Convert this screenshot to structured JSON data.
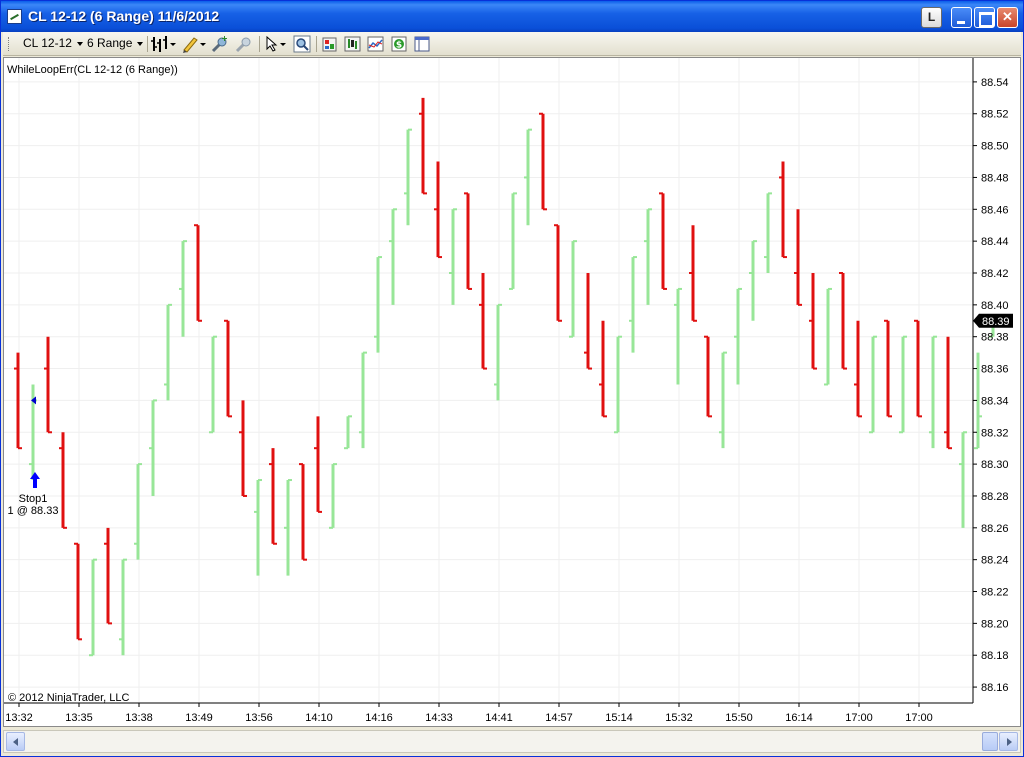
{
  "window": {
    "title": "CL 12-12 (6 Range)  11/6/2012",
    "btn_l_label": "L"
  },
  "toolbar": {
    "instrument": "CL 12-12",
    "period": "6 Range",
    "icons": [
      "bar-style-icon",
      "pencil-draw-icon",
      "zoom-in-icon",
      "zoom-out-icon",
      "pointer-icon",
      "magnifier-icon",
      "properties-icon",
      "strategies-icon",
      "indicators-icon",
      "data-box-icon",
      "window-linking-icon"
    ]
  },
  "chart_data": {
    "type": "ohlc-bar",
    "title": "WhileLoopErr(CL 12-12 (6 Range))",
    "copyright": "© 2012 NinjaTrader, LLC",
    "ylim": [
      88.15,
      88.555
    ],
    "yticks": [
      88.16,
      88.18,
      88.2,
      88.22,
      88.24,
      88.26,
      88.28,
      88.3,
      88.32,
      88.34,
      88.36,
      88.38,
      88.4,
      88.42,
      88.44,
      88.46,
      88.48,
      88.5,
      88.52,
      88.54
    ],
    "xticks": [
      {
        "label": "13:32",
        "bar": 0
      },
      {
        "label": "13:35",
        "bar": 4
      },
      {
        "label": "13:38",
        "bar": 8
      },
      {
        "label": "13:49",
        "bar": 12
      },
      {
        "label": "13:56",
        "bar": 16
      },
      {
        "label": "14:10",
        "bar": 20
      },
      {
        "label": "14:16",
        "bar": 24
      },
      {
        "label": "14:33",
        "bar": 28
      },
      {
        "label": "14:41",
        "bar": 32
      },
      {
        "label": "14:57",
        "bar": 36
      },
      {
        "label": "15:14",
        "bar": 40
      },
      {
        "label": "15:32",
        "bar": 44
      },
      {
        "label": "15:50",
        "bar": 48
      },
      {
        "label": "16:14",
        "bar": 52
      },
      {
        "label": "17:00",
        "bar": 56
      },
      {
        "label": "17:00",
        "bar": 60
      }
    ],
    "last_price": "88.39",
    "up_color": "#98E698",
    "down_color": "#E01010",
    "bars": [
      {
        "o": 88.36,
        "h": 88.37,
        "l": 88.31,
        "c": 88.31
      },
      {
        "o": 88.3,
        "h": 88.35,
        "l": 88.29,
        "c": 88.34
      },
      {
        "o": 88.36,
        "h": 88.38,
        "l": 88.32,
        "c": 88.32
      },
      {
        "o": 88.31,
        "h": 88.32,
        "l": 88.26,
        "c": 88.26
      },
      {
        "o": 88.25,
        "h": 88.25,
        "l": 88.19,
        "c": 88.19
      },
      {
        "o": 88.18,
        "h": 88.24,
        "l": 88.18,
        "c": 88.24
      },
      {
        "o": 88.25,
        "h": 88.26,
        "l": 88.2,
        "c": 88.2
      },
      {
        "o": 88.19,
        "h": 88.24,
        "l": 88.18,
        "c": 88.24
      },
      {
        "o": 88.25,
        "h": 88.3,
        "l": 88.24,
        "c": 88.3
      },
      {
        "o": 88.31,
        "h": 88.34,
        "l": 88.28,
        "c": 88.34
      },
      {
        "o": 88.35,
        "h": 88.4,
        "l": 88.34,
        "c": 88.4
      },
      {
        "o": 88.41,
        "h": 88.44,
        "l": 88.38,
        "c": 88.44
      },
      {
        "o": 88.45,
        "h": 88.45,
        "l": 88.39,
        "c": 88.39
      },
      {
        "o": 88.32,
        "h": 88.38,
        "l": 88.32,
        "c": 88.38
      },
      {
        "o": 88.39,
        "h": 88.39,
        "l": 88.33,
        "c": 88.33
      },
      {
        "o": 88.32,
        "h": 88.34,
        "l": 88.28,
        "c": 88.28
      },
      {
        "o": 88.27,
        "h": 88.29,
        "l": 88.23,
        "c": 88.29
      },
      {
        "o": 88.3,
        "h": 88.31,
        "l": 88.25,
        "c": 88.25
      },
      {
        "o": 88.26,
        "h": 88.29,
        "l": 88.23,
        "c": 88.29
      },
      {
        "o": 88.3,
        "h": 88.3,
        "l": 88.24,
        "c": 88.24
      },
      {
        "o": 88.31,
        "h": 88.33,
        "l": 88.27,
        "c": 88.27
      },
      {
        "o": 88.26,
        "h": 88.3,
        "l": 88.26,
        "c": 88.3
      },
      {
        "o": 88.31,
        "h": 88.33,
        "l": 88.31,
        "c": 88.33
      },
      {
        "o": 88.32,
        "h": 88.37,
        "l": 88.31,
        "c": 88.37
      },
      {
        "o": 88.38,
        "h": 88.43,
        "l": 88.37,
        "c": 88.43
      },
      {
        "o": 88.44,
        "h": 88.46,
        "l": 88.4,
        "c": 88.46
      },
      {
        "o": 88.47,
        "h": 88.51,
        "l": 88.45,
        "c": 88.51
      },
      {
        "o": 88.52,
        "h": 88.53,
        "l": 88.47,
        "c": 88.47
      },
      {
        "o": 88.46,
        "h": 88.49,
        "l": 88.43,
        "c": 88.43
      },
      {
        "o": 88.42,
        "h": 88.46,
        "l": 88.4,
        "c": 88.46
      },
      {
        "o": 88.47,
        "h": 88.47,
        "l": 88.41,
        "c": 88.41
      },
      {
        "o": 88.4,
        "h": 88.42,
        "l": 88.36,
        "c": 88.36
      },
      {
        "o": 88.35,
        "h": 88.4,
        "l": 88.34,
        "c": 88.4
      },
      {
        "o": 88.41,
        "h": 88.47,
        "l": 88.41,
        "c": 88.47
      },
      {
        "o": 88.48,
        "h": 88.51,
        "l": 88.45,
        "c": 88.51
      },
      {
        "o": 88.52,
        "h": 88.52,
        "l": 88.46,
        "c": 88.46
      },
      {
        "o": 88.45,
        "h": 88.45,
        "l": 88.39,
        "c": 88.39
      },
      {
        "o": 88.38,
        "h": 88.44,
        "l": 88.38,
        "c": 88.44
      },
      {
        "o": 88.37,
        "h": 88.42,
        "l": 88.36,
        "c": 88.36
      },
      {
        "o": 88.35,
        "h": 88.39,
        "l": 88.33,
        "c": 88.33
      },
      {
        "o": 88.32,
        "h": 88.38,
        "l": 88.32,
        "c": 88.38
      },
      {
        "o": 88.39,
        "h": 88.43,
        "l": 88.37,
        "c": 88.43
      },
      {
        "o": 88.44,
        "h": 88.46,
        "l": 88.4,
        "c": 88.46
      },
      {
        "o": 88.47,
        "h": 88.47,
        "l": 88.41,
        "c": 88.41
      },
      {
        "o": 88.4,
        "h": 88.41,
        "l": 88.35,
        "c": 88.41
      },
      {
        "o": 88.42,
        "h": 88.45,
        "l": 88.39,
        "c": 88.39
      },
      {
        "o": 88.38,
        "h": 88.38,
        "l": 88.33,
        "c": 88.33
      },
      {
        "o": 88.32,
        "h": 88.37,
        "l": 88.31,
        "c": 88.37
      },
      {
        "o": 88.38,
        "h": 88.41,
        "l": 88.35,
        "c": 88.41
      },
      {
        "o": 88.42,
        "h": 88.44,
        "l": 88.39,
        "c": 88.44
      },
      {
        "o": 88.43,
        "h": 88.47,
        "l": 88.42,
        "c": 88.47
      },
      {
        "o": 88.48,
        "h": 88.49,
        "l": 88.43,
        "c": 88.43
      },
      {
        "o": 88.42,
        "h": 88.46,
        "l": 88.4,
        "c": 88.4
      },
      {
        "o": 88.39,
        "h": 88.42,
        "l": 88.36,
        "c": 88.36
      },
      {
        "o": 88.35,
        "h": 88.41,
        "l": 88.35,
        "c": 88.41
      },
      {
        "o": 88.42,
        "h": 88.42,
        "l": 88.36,
        "c": 88.36
      },
      {
        "o": 88.35,
        "h": 88.39,
        "l": 88.33,
        "c": 88.33
      },
      {
        "o": 88.32,
        "h": 88.38,
        "l": 88.32,
        "c": 88.38
      },
      {
        "o": 88.39,
        "h": 88.39,
        "l": 88.33,
        "c": 88.33
      },
      {
        "o": 88.32,
        "h": 88.38,
        "l": 88.32,
        "c": 88.38
      },
      {
        "o": 88.39,
        "h": 88.39,
        "l": 88.33,
        "c": 88.33
      },
      {
        "o": 88.32,
        "h": 88.38,
        "l": 88.31,
        "c": 88.38
      },
      {
        "o": 88.32,
        "h": 88.38,
        "l": 88.31,
        "c": 88.31
      },
      {
        "o": 88.3,
        "h": 88.32,
        "l": 88.26,
        "c": 88.32
      },
      {
        "o": 88.31,
        "h": 88.37,
        "l": 88.31,
        "c": 88.33
      },
      {
        "o": 88.38,
        "h": 88.39,
        "l": 88.38,
        "c": 88.39
      }
    ],
    "annotations": [
      {
        "type": "entry-marker",
        "bar": 1,
        "price": 88.34
      },
      {
        "type": "stop-arrow",
        "bar": 1,
        "price": 88.285,
        "label": "Stop1",
        "sublabel": "1 @ 88.33"
      }
    ]
  }
}
